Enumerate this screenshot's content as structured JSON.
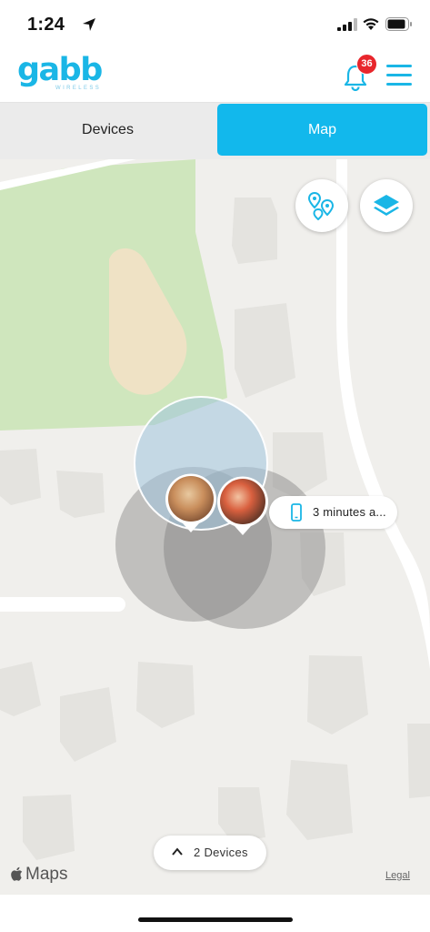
{
  "status_bar": {
    "time": "1:24",
    "icons": [
      "location-arrow-icon",
      "cellular-signal-icon",
      "wifi-icon",
      "battery-icon"
    ]
  },
  "header": {
    "logo_text": "gabb",
    "logo_subtext": "WIRELESS",
    "notification_count": "36",
    "icons": [
      "bell-icon",
      "hamburger-menu-icon"
    ]
  },
  "tabs": [
    {
      "label": "Devices",
      "active": false
    },
    {
      "label": "Map",
      "active": true
    }
  ],
  "map": {
    "callout_text": "3 minutes a...",
    "devices_pill_label": "2 Devices",
    "attribution": "Maps",
    "legal_link": "Legal",
    "buttons": [
      "multi-pin-icon",
      "layers-icon"
    ]
  },
  "colors": {
    "accent": "#12b8ec",
    "badge": "#e8262c",
    "park": "#cfe6bd",
    "map_bg": "#f0efec"
  }
}
